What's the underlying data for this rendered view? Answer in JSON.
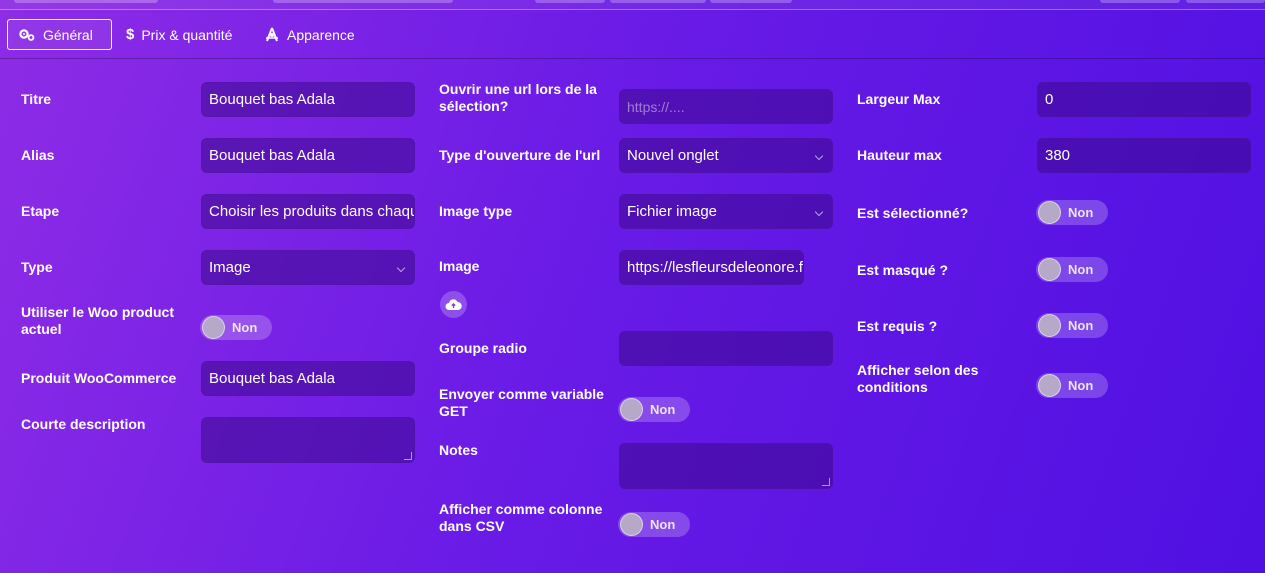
{
  "tabs": [
    {
      "label": "Général",
      "icon": "gears-icon",
      "active": true
    },
    {
      "label": "Prix & quantité",
      "icon": "dollar-icon",
      "active": false
    },
    {
      "label": "Apparence",
      "icon": "palette-icon",
      "active": false
    }
  ],
  "col1": {
    "titre": {
      "label": "Titre",
      "value": "Bouquet bas Adala"
    },
    "alias": {
      "label": "Alias",
      "value": "Bouquet bas Adala"
    },
    "etape": {
      "label": "Etape",
      "value": "Choisir les produits dans chaqu"
    },
    "type": {
      "label": "Type",
      "value": "Image"
    },
    "woo_actuel": {
      "label": "Utiliser le Woo product actuel",
      "state": "Non"
    },
    "produit": {
      "label": "Produit WooCommerce",
      "value": "Bouquet bas Adala"
    },
    "description": {
      "label": "Courte description",
      "value": ""
    }
  },
  "col2": {
    "url": {
      "label": "Ouvrir une url lors de la sélection?",
      "placeholder": "https://...."
    },
    "url_type": {
      "label": "Type d'ouverture de l'url",
      "value": "Nouvel onglet"
    },
    "image_type": {
      "label": "Image type",
      "value": "Fichier image"
    },
    "image": {
      "label": "Image",
      "value": "https://lesfleursdeleonore.f"
    },
    "groupe_radio": {
      "label": "Groupe radio",
      "value": ""
    },
    "get_var": {
      "label": "Envoyer comme variable GET",
      "state": "Non"
    },
    "notes": {
      "label": "Notes",
      "value": ""
    },
    "csv": {
      "label": "Afficher comme colonne dans CSV",
      "state": "Non"
    }
  },
  "col3": {
    "largeur": {
      "label": "Largeur Max",
      "value": "0"
    },
    "hauteur": {
      "label": "Hauteur max",
      "value": "380"
    },
    "selectionne": {
      "label": "Est sélectionné?",
      "state": "Non"
    },
    "masque": {
      "label": "Est masqué ?",
      "state": "Non"
    },
    "requis": {
      "label": "Est requis ?",
      "state": "Non"
    },
    "conditions": {
      "label": "Afficher selon des conditions",
      "state": "Non"
    }
  }
}
